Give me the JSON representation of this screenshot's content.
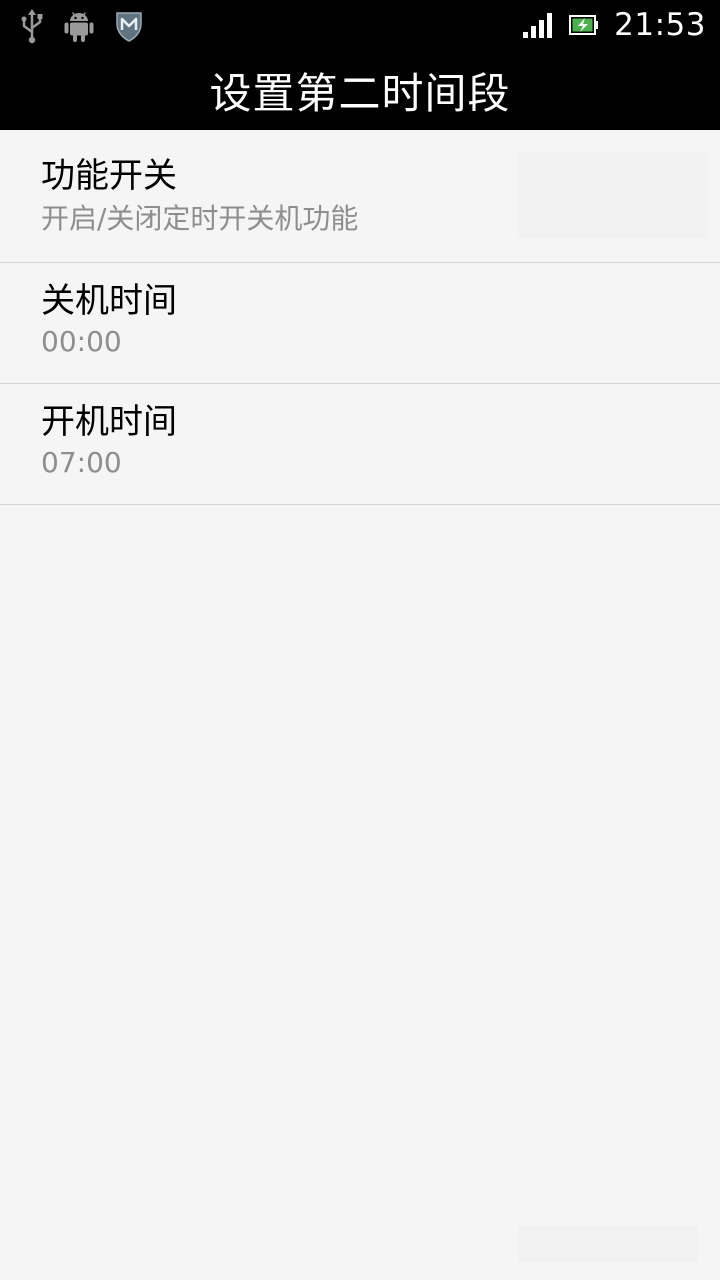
{
  "status_bar": {
    "time": "21:53",
    "icons": [
      "usb-icon",
      "android-debug-icon",
      "mcafee-shield-icon",
      "signal-icon",
      "battery-charging-icon"
    ]
  },
  "title_bar": {
    "title": "设置第二时间段"
  },
  "settings": {
    "items": [
      {
        "title": "功能开关",
        "summary": "开启/关闭定时开关机功能"
      },
      {
        "title": "关机时间",
        "summary": "00:00"
      },
      {
        "title": "开机时间",
        "summary": "07:00"
      }
    ]
  },
  "colors": {
    "bar_background": "#000000",
    "list_background": "#f5f5f5",
    "title_text": "#000000",
    "summary_text": "#8e8e8e",
    "divider": "#d4d4d4",
    "battery_accent": "#4caf50"
  }
}
